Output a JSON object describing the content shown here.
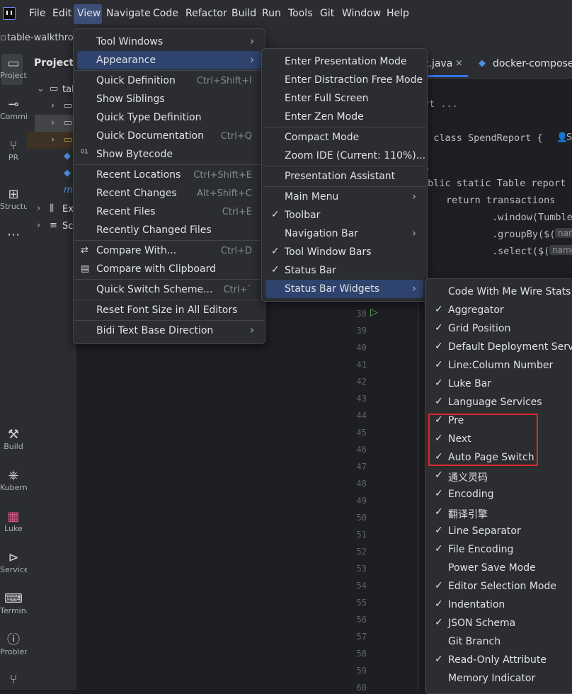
{
  "main_menu": [
    "File",
    "Edit",
    "View",
    "Navigate",
    "Code",
    "Refactor",
    "Build",
    "Run",
    "Tools",
    "Git",
    "Window",
    "Help"
  ],
  "nav": {
    "project_crumb": "table-walkthrou"
  },
  "tool_windows": [
    "Project",
    "Commit",
    "PR",
    "Structure",
    "Build",
    "Kubernetes",
    "Luke",
    "Services",
    "Terminal",
    "Problems"
  ],
  "project_panel": {
    "title": "Project",
    "tree_root": "tab",
    "tree_items": [
      "Ex",
      "Sc"
    ]
  },
  "editor": {
    "tabs": [
      "t.java",
      "docker-compose.y"
    ],
    "code_lines": [
      "rt ...",
      "c class SpendReport {",
      "ublic static Table report",
      "return transactions",
      ".window(Tumble",
      ".groupBy($(",
      ".select($("
    ],
    "hints": [
      "nam",
      "name"
    ],
    "author_hint": "S",
    "line_numbers": [
      "38",
      "39",
      "40",
      "41",
      "42",
      "43",
      "44",
      "45",
      "46",
      "47",
      "48",
      "49",
      "50",
      "51",
      "52",
      "53",
      "54",
      "55",
      "56",
      "57",
      "58",
      "59",
      "60"
    ]
  },
  "view_menu": {
    "items": [
      {
        "label": "Tool Windows",
        "submenu": true
      },
      {
        "label": "Appearance",
        "submenu": true
      },
      {
        "label": "Quick Definition",
        "shortcut": "Ctrl+Shift+I"
      },
      {
        "label": "Show Siblings"
      },
      {
        "label": "Quick Type Definition"
      },
      {
        "label": "Quick Documentation",
        "shortcut": "Ctrl+Q"
      },
      {
        "label": "Show Bytecode",
        "icon": "bytecode-icon"
      },
      {
        "label": "Recent Locations",
        "shortcut": "Ctrl+Shift+E"
      },
      {
        "label": "Recent Changes",
        "shortcut": "Alt+Shift+C"
      },
      {
        "label": "Recent Files",
        "shortcut": "Ctrl+E"
      },
      {
        "label": "Recently Changed Files"
      },
      {
        "label": "Compare With...",
        "shortcut": "Ctrl+D",
        "icon": "compare-icon"
      },
      {
        "label": "Compare with Clipboard",
        "icon": "clipboard-icon"
      },
      {
        "label": "Quick Switch Scheme...",
        "shortcut": "Ctrl+`"
      },
      {
        "label": "Reset Font Size in All Editors"
      },
      {
        "label": "Bidi Text Base Direction",
        "submenu": true
      }
    ]
  },
  "appearance_menu": {
    "items": [
      {
        "label": "Enter Presentation Mode"
      },
      {
        "label": "Enter Distraction Free Mode"
      },
      {
        "label": "Enter Full Screen"
      },
      {
        "label": "Enter Zen Mode"
      },
      {
        "label": "Compact Mode"
      },
      {
        "label": "Zoom IDE (Current: 110%)..."
      },
      {
        "label": "Presentation Assistant"
      },
      {
        "label": "Main Menu",
        "submenu": true
      },
      {
        "label": "Toolbar",
        "checked": true
      },
      {
        "label": "Navigation Bar",
        "submenu": true
      },
      {
        "label": "Tool Window Bars",
        "checked": true
      },
      {
        "label": "Status Bar",
        "checked": true
      },
      {
        "label": "Status Bar Widgets",
        "submenu": true
      }
    ]
  },
  "widgets_menu": {
    "items": [
      {
        "label": "Code With Me Wire Stats",
        "checked": false
      },
      {
        "label": "Aggregator",
        "checked": true
      },
      {
        "label": "Grid Position",
        "checked": true
      },
      {
        "label": "Default Deployment Server",
        "checked": true
      },
      {
        "label": "Line:Column Number",
        "checked": true
      },
      {
        "label": "Luke Bar",
        "checked": true
      },
      {
        "label": "Language Services",
        "checked": true
      },
      {
        "label": "Pre",
        "checked": true
      },
      {
        "label": "Next",
        "checked": true
      },
      {
        "label": "Auto Page Switch",
        "checked": true
      },
      {
        "label": "通义灵码",
        "checked": true
      },
      {
        "label": "Encoding",
        "checked": true
      },
      {
        "label": "翻译引擎",
        "checked": true
      },
      {
        "label": "Line Separator",
        "checked": true
      },
      {
        "label": "File Encoding",
        "checked": true
      },
      {
        "label": "Power Save Mode",
        "checked": false
      },
      {
        "label": "Editor Selection Mode",
        "checked": true
      },
      {
        "label": "Indentation",
        "checked": true
      },
      {
        "label": "JSON Schema",
        "checked": true
      },
      {
        "label": "Git Branch",
        "checked": false
      },
      {
        "label": "Read-Only Attribute",
        "checked": true
      },
      {
        "label": "Memory Indicator",
        "checked": false
      }
    ]
  },
  "glyphs": {
    "check": "✓",
    "arrow": "›",
    "more": "⋯"
  },
  "colors": {
    "selection": "#2e436e",
    "highlight_box": "#e0282e",
    "accent": "#3574f0"
  }
}
